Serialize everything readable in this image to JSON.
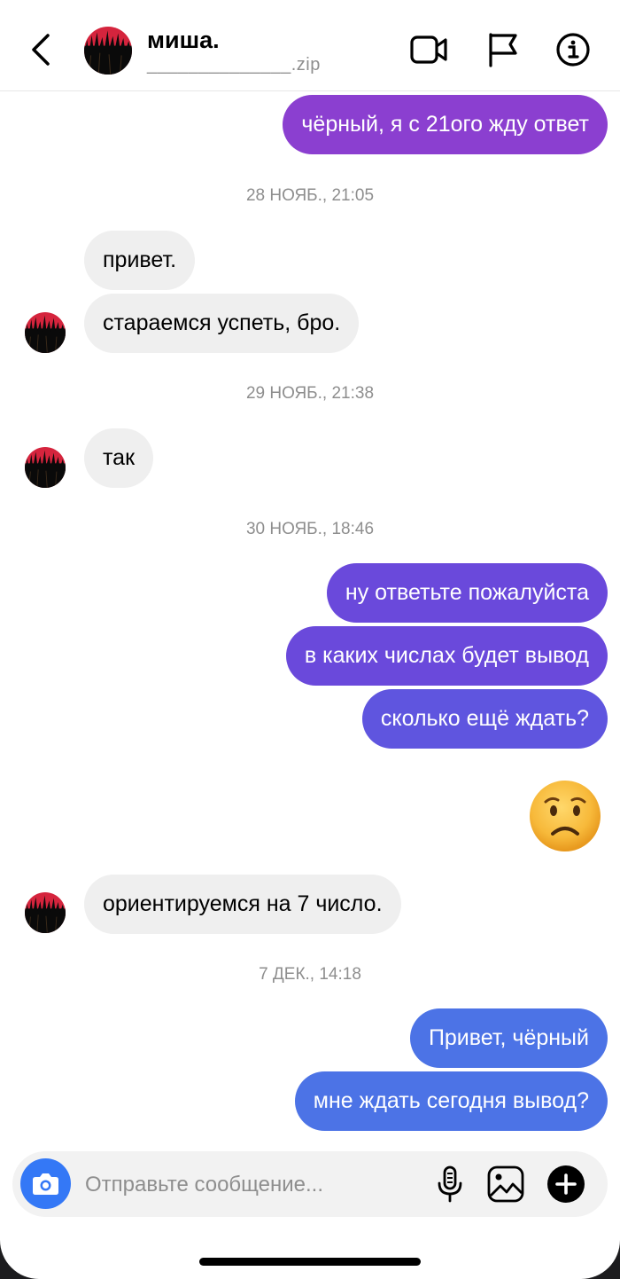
{
  "header": {
    "contact_name": "миша.",
    "contact_subtitle": "______________.zip"
  },
  "colors": {
    "incoming_bubble": "#efefef",
    "outgoing_purple": "#8b3fd0",
    "outgoing_indigo": "#6a49db",
    "outgoing_blue": "#4c73e6",
    "camera_button": "#3478f6"
  },
  "messages": [
    {
      "type": "out",
      "text": "чёрный, я с 21ого жду ответ"
    },
    {
      "type": "timestamp",
      "text": "28 НОЯБ., 21:05"
    },
    {
      "type": "in",
      "text": "привет."
    },
    {
      "type": "in",
      "text": "стараемся успеть, бро."
    },
    {
      "type": "timestamp",
      "text": "29 НОЯБ., 21:38"
    },
    {
      "type": "in",
      "text": "так"
    },
    {
      "type": "timestamp",
      "text": "30 НОЯБ., 18:46"
    },
    {
      "type": "out",
      "text": "ну ответьте пожалуйста"
    },
    {
      "type": "out",
      "text": "в каких числах будет вывод"
    },
    {
      "type": "out",
      "text": "сколько ещё ждать?"
    },
    {
      "type": "out-emoji",
      "emoji": "worried-face"
    },
    {
      "type": "in",
      "text": "ориентируемся на 7 число."
    },
    {
      "type": "timestamp",
      "text": "7 ДЕК., 14:18"
    },
    {
      "type": "out",
      "text": "Привет, чёрный"
    },
    {
      "type": "out",
      "text": "мне ждать сегодня вывод?"
    }
  ],
  "composer": {
    "placeholder": "Отправьте сообщение..."
  },
  "icons": {
    "back": "chevron-left-icon",
    "video": "video-camera-icon",
    "report": "flag-icon",
    "info": "info-icon",
    "camera": "camera-icon",
    "mic": "microphone-icon",
    "gallery": "image-icon",
    "more": "plus-circle-icon"
  }
}
